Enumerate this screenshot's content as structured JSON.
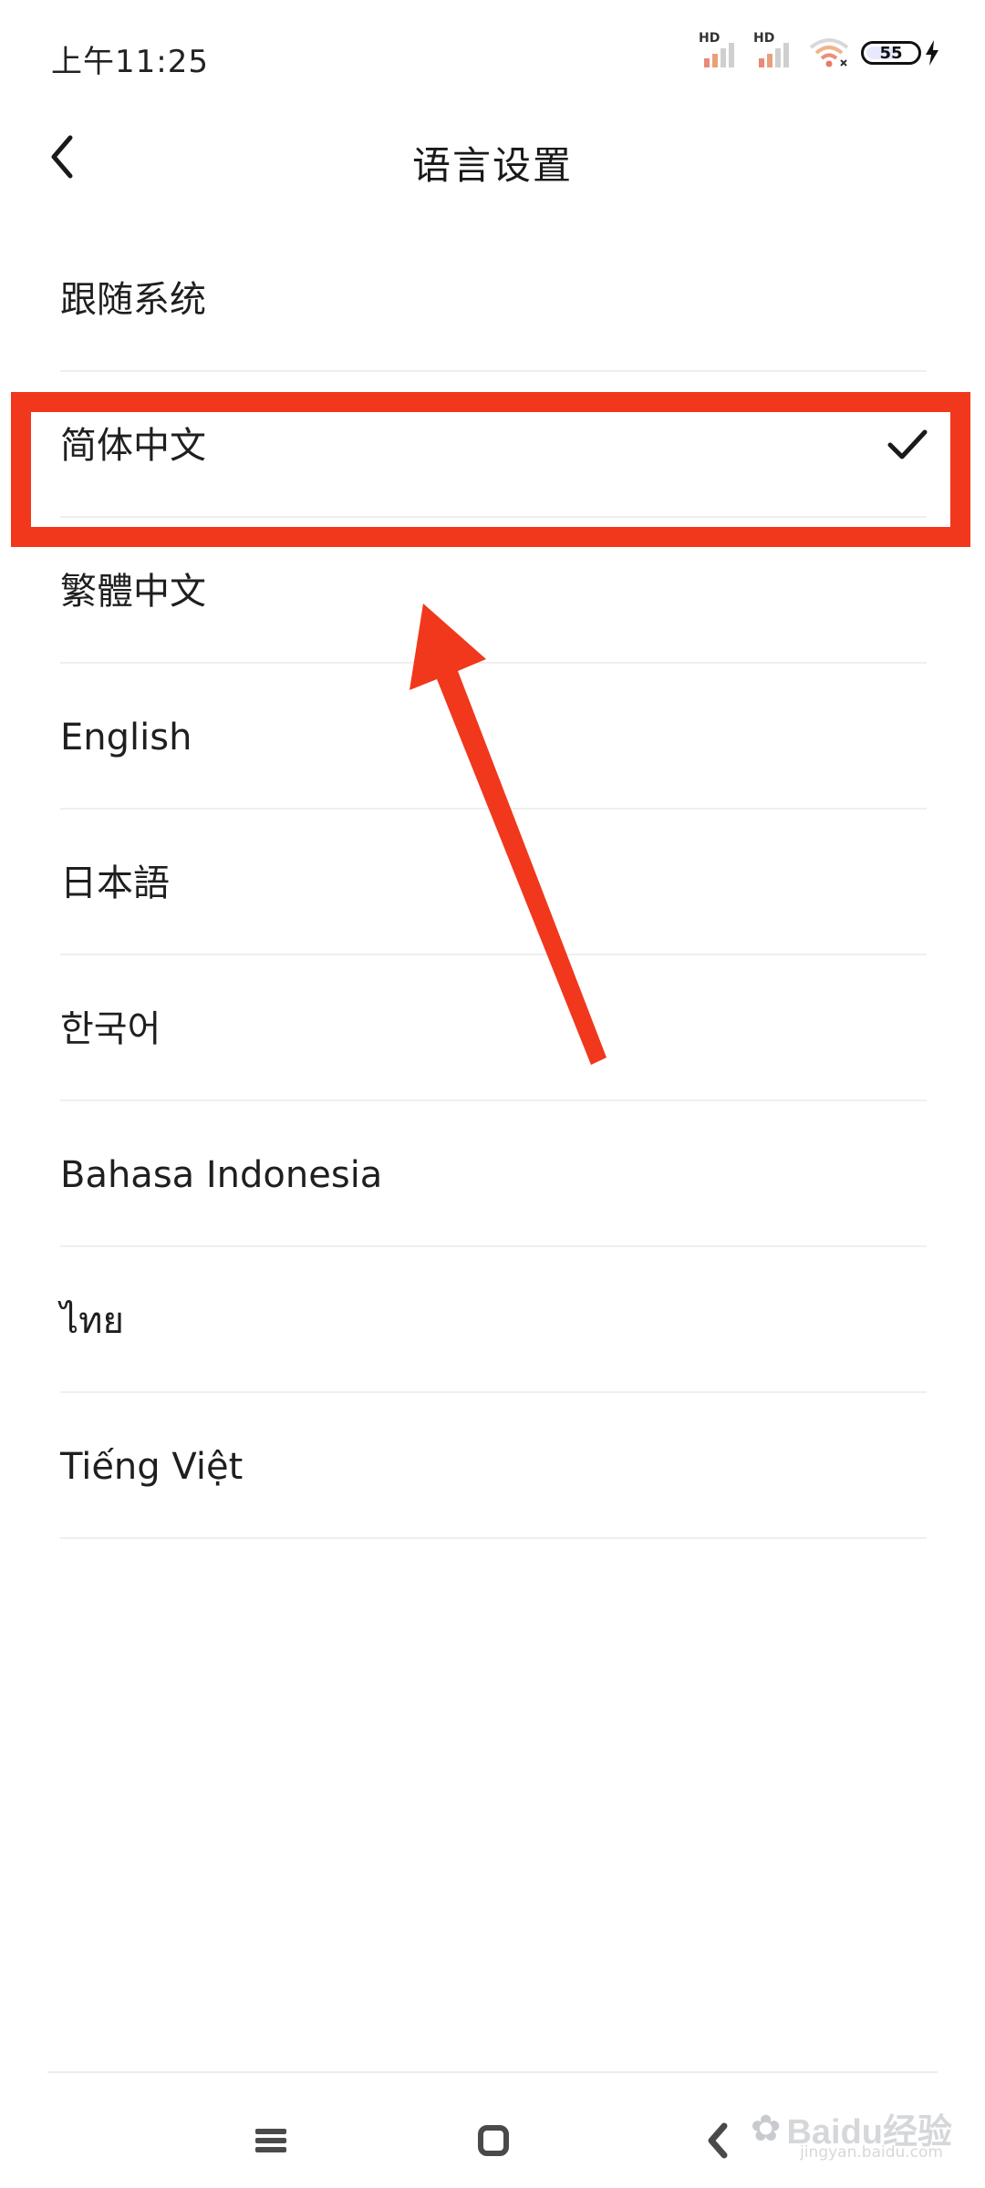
{
  "status_bar": {
    "time": "上午11:25",
    "signal_1_label": "HD",
    "signal_2_label": "HD",
    "battery_level": "55",
    "icons": [
      "signal-bars-icon",
      "signal-bars-icon",
      "wifi-icon",
      "battery-icon",
      "charging-bolt-icon"
    ]
  },
  "header": {
    "title": "语言设置",
    "back_icon": "chevron-left-icon"
  },
  "languages": [
    {
      "label": "跟随系统",
      "selected": false
    },
    {
      "label": "简体中文",
      "selected": true
    },
    {
      "label": "繁體中文",
      "selected": false
    },
    {
      "label": "English",
      "selected": false
    },
    {
      "label": "日本語",
      "selected": false
    },
    {
      "label": "한국어",
      "selected": false
    },
    {
      "label": "Bahasa Indonesia",
      "selected": false
    },
    {
      "label": "ไทย",
      "selected": false
    },
    {
      "label": "Tiếng Việt",
      "selected": false
    }
  ],
  "selected_icon": "checkmark-icon",
  "annotation": {
    "highlight_color": "#f1371c",
    "arrow_color": "#f1371c"
  },
  "nav_bar": {
    "icons": [
      "menu-icon",
      "home-icon",
      "back-icon"
    ]
  },
  "watermark": {
    "brand": "Baidu经验",
    "url": "jingyan.baidu.com"
  }
}
